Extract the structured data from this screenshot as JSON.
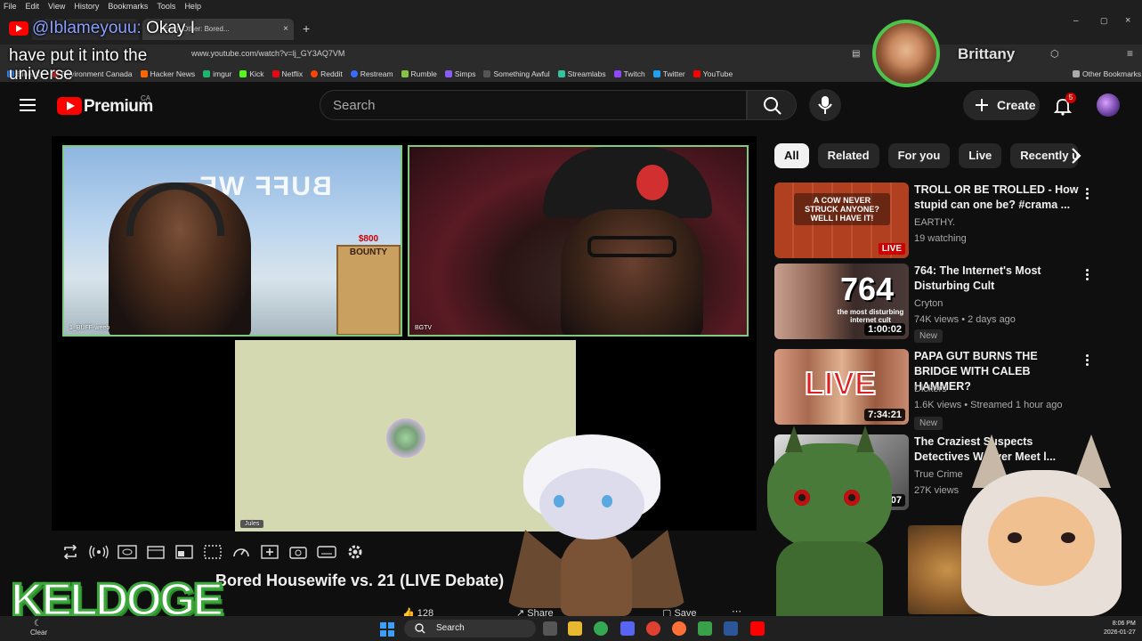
{
  "browser": {
    "menu": [
      "File",
      "Edit",
      "View",
      "History",
      "Bookmarks",
      "Tools",
      "Help"
    ],
    "tabs": [
      {
        "label": "...Each Other: Bored..."
      }
    ],
    "url": "www.youtube.com/watch?v=lj_GY3AQ7VM",
    "bookmarks": [
      {
        "label": "Bluesky",
        "color": "#3a8cff"
      },
      {
        "label": "Environment Canada",
        "color": "#cc3333"
      },
      {
        "label": "Hacker News",
        "color": "#ff6600"
      },
      {
        "label": "imgur",
        "color": "#1bb76e"
      },
      {
        "label": "Kick",
        "color": "#53fc18"
      },
      {
        "label": "Netflix",
        "color": "#e50914"
      },
      {
        "label": "Reddit",
        "color": "#ff4500"
      },
      {
        "label": "Restream",
        "color": "#3a6cff"
      },
      {
        "label": "Rumble",
        "color": "#85c742"
      },
      {
        "label": "Simps",
        "color": "#8a5cf6"
      },
      {
        "label": "Something Awful",
        "color": "#333333"
      },
      {
        "label": "Streamlabs",
        "color": "#31c3a2"
      },
      {
        "label": "Twitch",
        "color": "#9146ff"
      },
      {
        "label": "Twitter",
        "color": "#1da1f2"
      },
      {
        "label": "YouTube",
        "color": "#ff0000"
      }
    ],
    "other_bookmarks": "Other Bookmarks"
  },
  "chat": {
    "user": "@Iblameyouu:",
    "message_line1": "Okay I",
    "message_line2": "have put it into the",
    "message_line3": "universe"
  },
  "youtube": {
    "brand": "Premium",
    "region": "CA",
    "search_placeholder": "Search",
    "create_label": "Create",
    "notification_count": "5"
  },
  "player": {
    "cam1_label": "1_BUFF-weeb",
    "cam2_label": "BGTV",
    "cam3_label": "Jules",
    "sign_text": "BUFF WE",
    "bounty_text": "BOUNTY",
    "bounty_amount": "$800",
    "video_title": "Bored Housewife vs. 21 (LIVE Debate)",
    "likes": "128",
    "share_label": "Share",
    "save_label": "Save"
  },
  "chips": [
    {
      "label": "All",
      "active": true
    },
    {
      "label": "Related",
      "active": false
    },
    {
      "label": "For you",
      "active": false
    },
    {
      "label": "Live",
      "active": false
    },
    {
      "label": "Recently up",
      "active": false
    }
  ],
  "recommendations": [
    {
      "title": "TROLL OR BE TROLLED - How stupid can one be? #crama ...",
      "channel": "EARTHY.",
      "meta": "19 watching",
      "badge": "LIVE",
      "thumb_text": "A COW NEVER STRUCK ANYONE? WELL I HAVE IT!"
    },
    {
      "title": "764: The Internet's Most Disturbing Cult",
      "channel": "Cryton",
      "meta": "74K views • 2 days ago",
      "duration": "1:00:02",
      "new": "New",
      "thumb_text": "764",
      "thumb_sub": "the most disturbing internet cult"
    },
    {
      "title": "PAPA GUT BURNS THE BRIDGE WITH CALEB HAMMER?",
      "channel": "Dickers",
      "meta": "1.6K views • Streamed 1 hour ago",
      "duration": "7:34:21",
      "new": "New",
      "thumb_text": "LIVE"
    },
    {
      "title": "The Craziest Suspects Detectives W... ver Meet l...",
      "channel": "True Crime",
      "meta": "27K views",
      "duration": "6:07"
    }
  ],
  "overlays": {
    "guest_name": "Brittany",
    "streamer_logo": "KELDOGE"
  },
  "taskbar": {
    "weather": "Clear",
    "search_label": "Search",
    "time": "8:06 PM",
    "date": "2026-01-27"
  },
  "colors": {
    "accent_red": "#ff0000",
    "cam_border": "#7ecb7e",
    "chat_user": "#8aa0ff"
  }
}
